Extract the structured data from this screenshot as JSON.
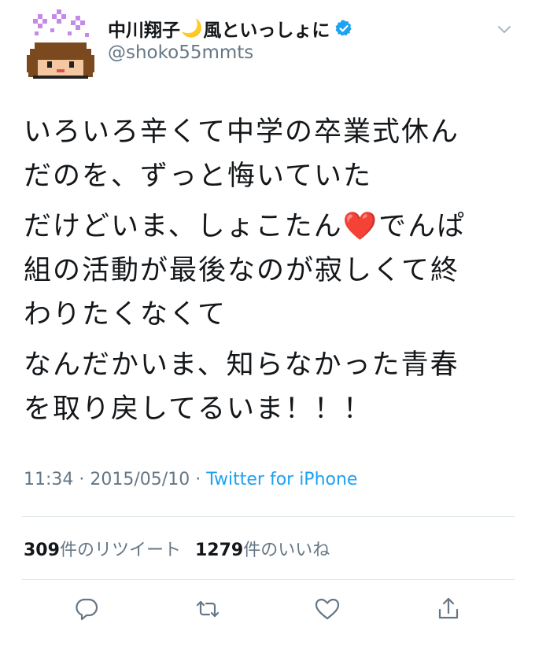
{
  "user": {
    "display_name": "中川翔子",
    "name_emoji": "🌙",
    "display_name_suffix": "風といっしょに",
    "handle": "@shoko55mmts",
    "verified": true
  },
  "tweet": {
    "paragraphs": [
      "いろいろ辛くて中学の卒業式休ん\nだのを、ずっと悔いていた",
      "だけどいま、しょこたん❤️でんぱ\n組の活動が最後なのが寂しくて終\nわりたくなくて",
      "なんだかいま、知らなかった青春\nを取り戻してるいま！！！"
    ],
    "time": "11:34",
    "date": "2015/05/10",
    "separator": "·",
    "source": "Twitter for iPhone"
  },
  "stats": {
    "retweets_count": "309",
    "retweets_label": "件のリツイート",
    "likes_count": "1279",
    "likes_label": "件のいいね"
  },
  "icons": {
    "menu": "chevron-down-icon",
    "reply": "reply-icon",
    "retweet": "retweet-icon",
    "like": "heart-icon",
    "share": "share-icon",
    "verified": "verified-badge-icon"
  },
  "colors": {
    "text": "#14171a",
    "secondary": "#657786",
    "link": "#1da1f2",
    "divider": "#e1e8ed"
  }
}
